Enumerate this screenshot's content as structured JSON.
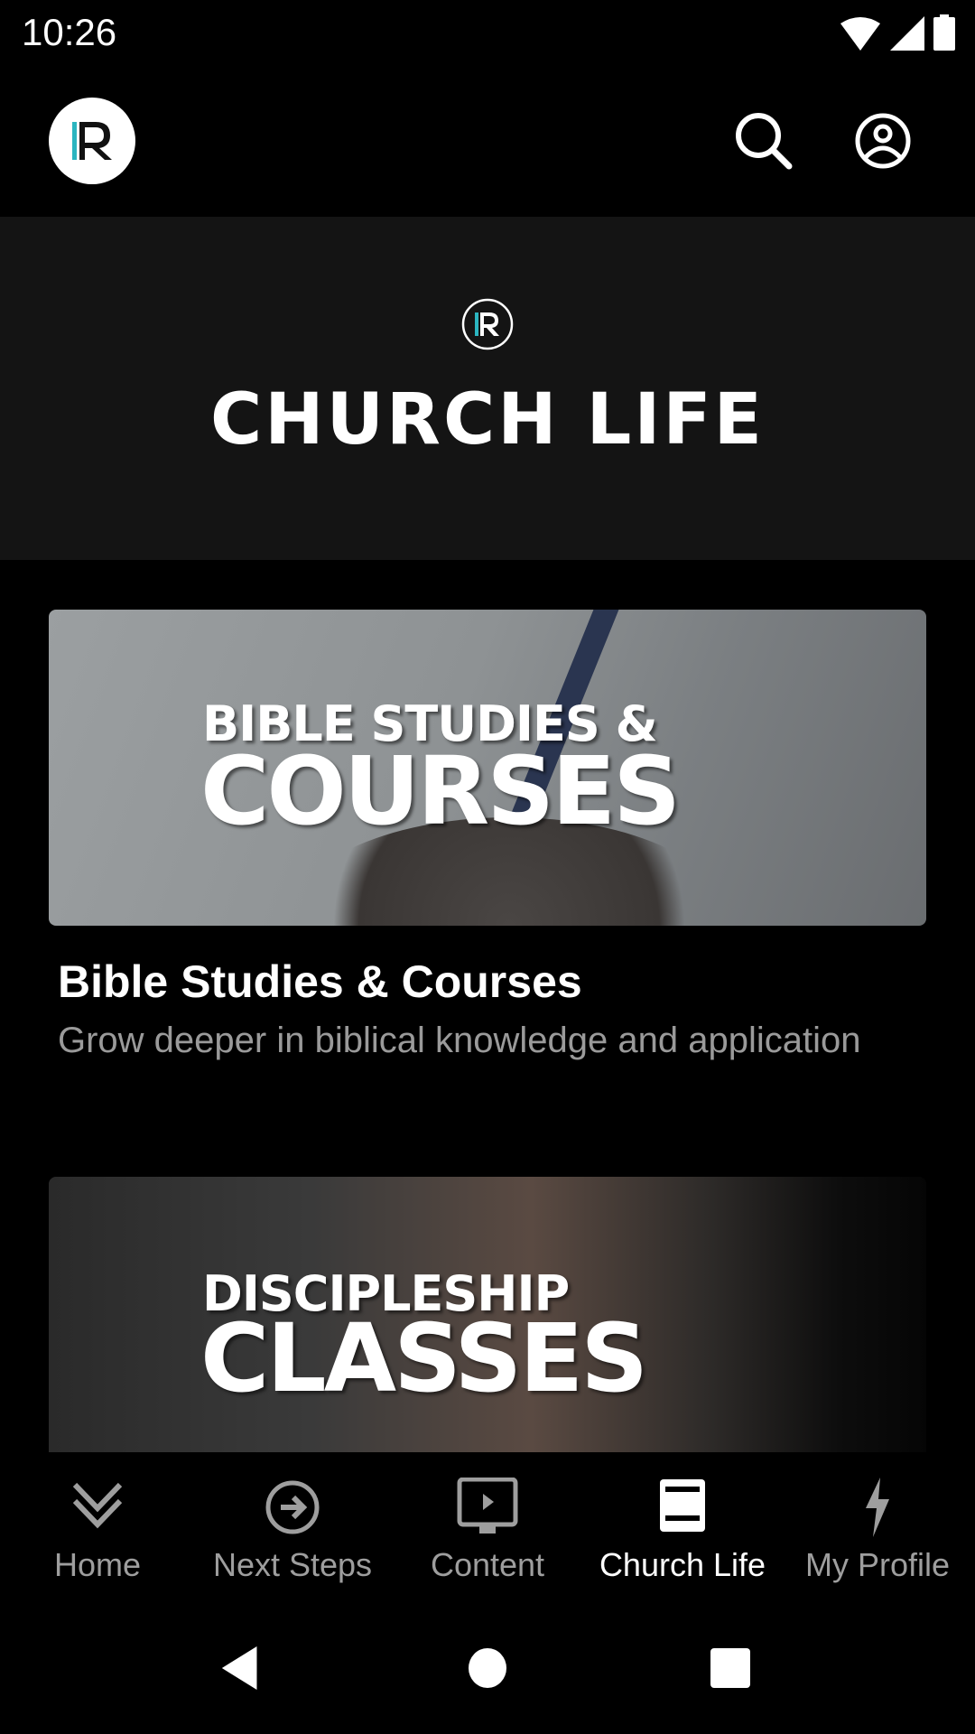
{
  "status_bar": {
    "time": "10:26",
    "icons": [
      "wifi-icon",
      "signal-icon",
      "battery-icon"
    ]
  },
  "app_bar": {
    "logo": "R",
    "actions": [
      "search-icon",
      "account-icon"
    ]
  },
  "hero": {
    "title": "CHURCH LIFE"
  },
  "cards": [
    {
      "image_line1": "BIBLE STUDIES &",
      "image_line2": "COURSES",
      "title": "Bible Studies & Courses",
      "subtitle": "Grow deeper in biblical knowledge and application"
    },
    {
      "image_line1": "DISCIPLESHIP",
      "image_line2": "CLASSES"
    }
  ],
  "bottom_nav": {
    "items": [
      {
        "label": "Home",
        "icon": "double-chevron-down-icon",
        "active": false
      },
      {
        "label": "Next Steps",
        "icon": "arrow-circle-right-icon",
        "active": false
      },
      {
        "label": "Content",
        "icon": "tv-play-icon",
        "active": false
      },
      {
        "label": "Church Life",
        "icon": "document-icon",
        "active": true
      },
      {
        "label": "My Profile",
        "icon": "lightning-icon",
        "active": false
      }
    ]
  },
  "colors": {
    "accent": "#2bb5c0",
    "inactive": "#9e9e9e",
    "hero_bg": "#141414"
  }
}
